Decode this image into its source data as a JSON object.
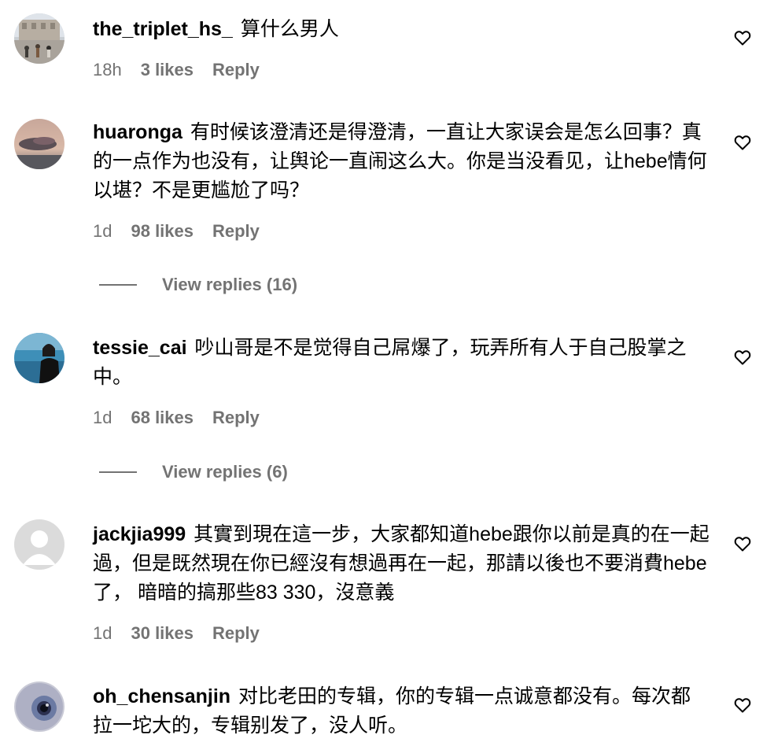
{
  "colors": {
    "secondary_text": "#737373",
    "primary_text": "#000000",
    "background": "#ffffff"
  },
  "comments": [
    {
      "username": "the_triplet_hs_",
      "text": "算什么男人",
      "time": "18h",
      "likes": "3 likes",
      "reply": "Reply",
      "avatar": "street-scene-photo"
    },
    {
      "username": "huaronga",
      "text": "有时候该澄清还是得澄清，一直让大家误会是怎么回事？真的一点作为也没有，让舆论一直闹这么大。你是当没看见，让hebe情何以堪？不是更尴尬了吗？",
      "time": "1d",
      "likes": "98 likes",
      "reply": "Reply",
      "avatar": "sunset-cloud-photo",
      "view_replies": "View replies (16)"
    },
    {
      "username": "tessie_cai",
      "text": "吵山哥是不是觉得自己屌爆了，玩弄所有人于自己股掌之中。",
      "time": "1d",
      "likes": "68 likes",
      "reply": "Reply",
      "avatar": "woman-by-sea-photo",
      "view_replies": "View replies (6)"
    },
    {
      "username": "jackjia999",
      "text": "其實到現在這一步，大家都知道hebe跟你以前是真的在一起過，但是既然現在你已經沒有想過再在一起，那請以後也不要消費hebe了， 暗暗的搞那些83 330，沒意義",
      "time": "1d",
      "likes": "30 likes",
      "reply": "Reply",
      "avatar": "default-user-icon"
    },
    {
      "username": "oh_chensanjin",
      "text": "对比老田的专辑，你的专辑一点诚意都没有。每次都拉一坨大的，专辑别发了，没人听。",
      "avatar": "eye-photo"
    }
  ]
}
